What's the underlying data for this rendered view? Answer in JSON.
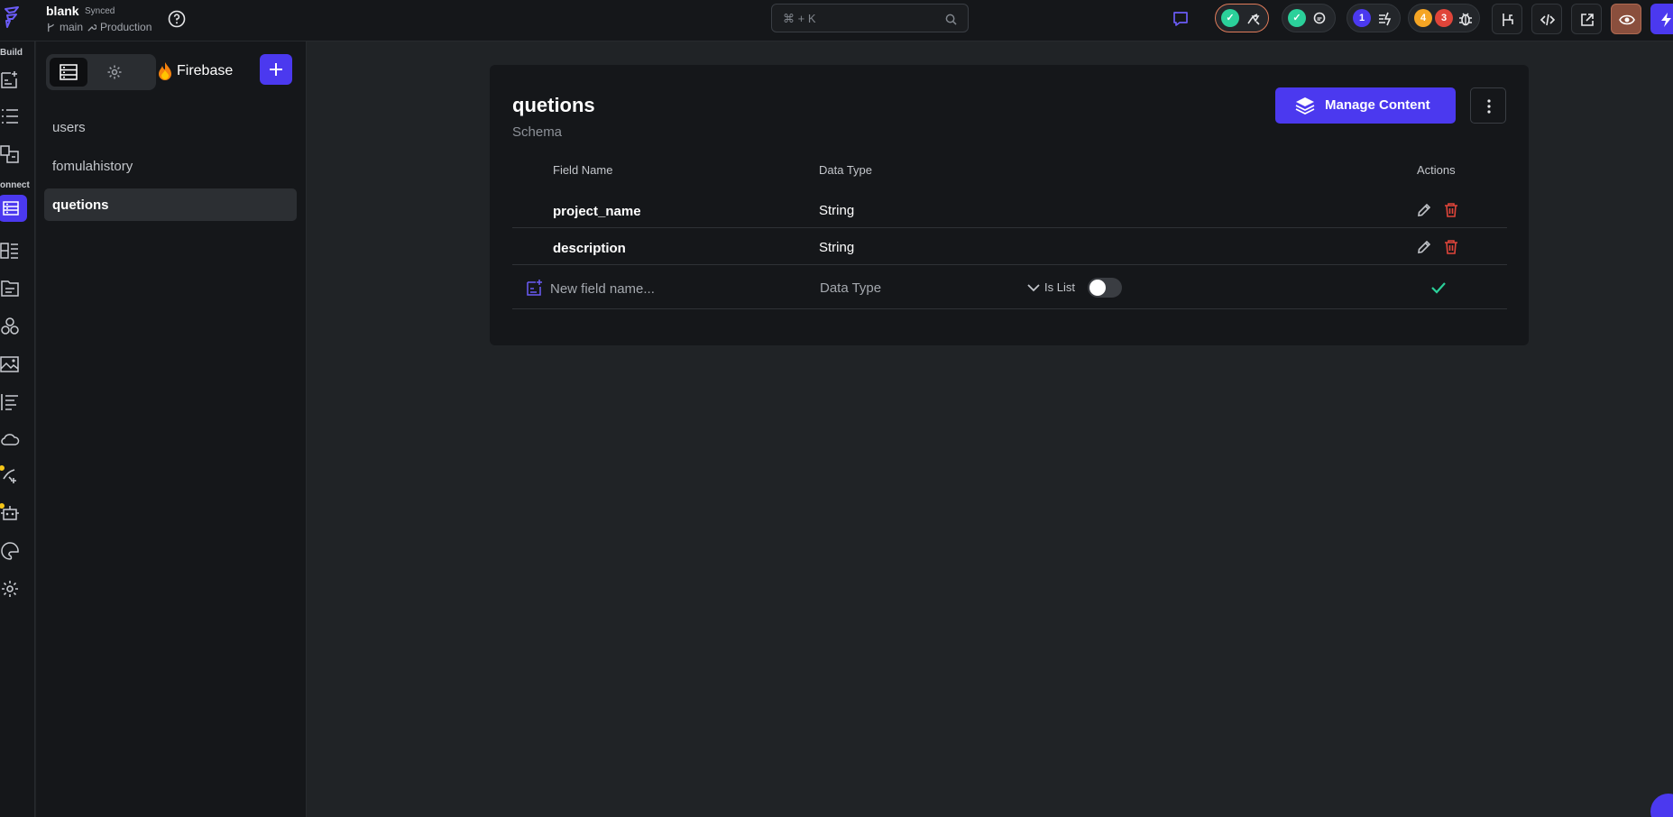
{
  "project": {
    "name": "blank",
    "sync_status": "Synced",
    "branch": "main",
    "environment": "Production"
  },
  "search": {
    "shortcut": "⌘ + K"
  },
  "status": {
    "flow_count": "1",
    "warning_count": "4",
    "error_count": "3"
  },
  "rail": {
    "build_label": "Build",
    "connect_label": "onnect"
  },
  "panel": {
    "provider": "Firebase",
    "collections": [
      {
        "label": "users"
      },
      {
        "label": "fomulahistory"
      },
      {
        "label": "quetions"
      }
    ]
  },
  "main": {
    "collection_title": "quetions",
    "subtitle": "Schema",
    "manage_content_label": "Manage Content",
    "headers": {
      "field_name": "Field Name",
      "data_type": "Data Type",
      "actions": "Actions"
    },
    "fields": [
      {
        "name": "project_name",
        "type": "String"
      },
      {
        "name": "description",
        "type": "String"
      }
    ],
    "new_field": {
      "placeholder": "New field name...",
      "type_placeholder": "Data Type",
      "is_list_label": "Is List",
      "is_list": false
    }
  },
  "colors": {
    "accent": "#4b39ef",
    "success": "#2bd09a",
    "danger": "#e0453a",
    "warning": "#f5a524"
  }
}
